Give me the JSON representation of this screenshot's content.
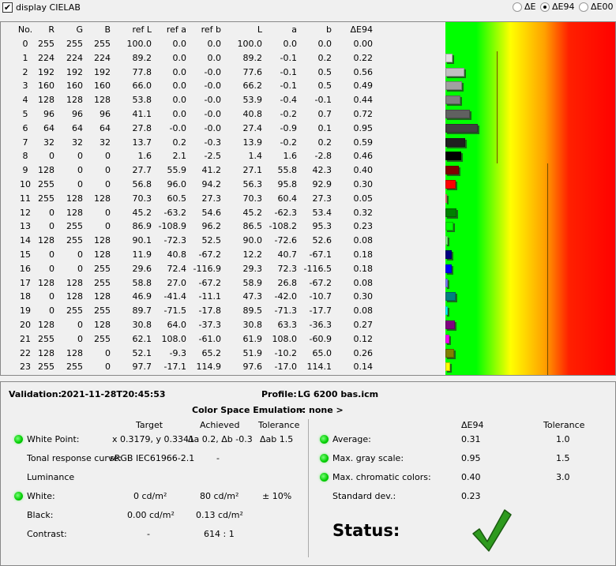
{
  "topbar": {
    "display_cielab_label": "display CIELAB",
    "display_cielab_checked": true,
    "metric_options": [
      "ΔE",
      "ΔE94",
      "ΔE00"
    ],
    "selected_metric": "ΔE94"
  },
  "table": {
    "headers": [
      "No.",
      "R",
      "G",
      "B",
      "ref L",
      "ref a",
      "ref b",
      "L",
      "a",
      "b",
      "ΔE94"
    ],
    "rows": [
      [
        "0",
        "255",
        "255",
        "255",
        "100.0",
        "0.0",
        "0.0",
        "100.0",
        "0.0",
        "0.0",
        "0.00"
      ],
      [
        "1",
        "224",
        "224",
        "224",
        "89.2",
        "0.0",
        "0.0",
        "89.2",
        "-0.1",
        "0.2",
        "0.22"
      ],
      [
        "2",
        "192",
        "192",
        "192",
        "77.8",
        "0.0",
        "-0.0",
        "77.6",
        "-0.1",
        "0.5",
        "0.56"
      ],
      [
        "3",
        "160",
        "160",
        "160",
        "66.0",
        "0.0",
        "-0.0",
        "66.2",
        "-0.1",
        "0.5",
        "0.49"
      ],
      [
        "4",
        "128",
        "128",
        "128",
        "53.8",
        "0.0",
        "-0.0",
        "53.9",
        "-0.4",
        "-0.1",
        "0.44"
      ],
      [
        "5",
        "96",
        "96",
        "96",
        "41.1",
        "0.0",
        "-0.0",
        "40.8",
        "-0.2",
        "0.7",
        "0.72"
      ],
      [
        "6",
        "64",
        "64",
        "64",
        "27.8",
        "-0.0",
        "-0.0",
        "27.4",
        "-0.9",
        "0.1",
        "0.95"
      ],
      [
        "7",
        "32",
        "32",
        "32",
        "13.7",
        "0.2",
        "-0.3",
        "13.9",
        "-0.2",
        "0.2",
        "0.59"
      ],
      [
        "8",
        "0",
        "0",
        "0",
        "1.6",
        "2.1",
        "-2.5",
        "1.4",
        "1.6",
        "-2.8",
        "0.46"
      ],
      [
        "9",
        "128",
        "0",
        "0",
        "27.7",
        "55.9",
        "41.2",
        "27.1",
        "55.8",
        "42.3",
        "0.40"
      ],
      [
        "10",
        "255",
        "0",
        "0",
        "56.8",
        "96.0",
        "94.2",
        "56.3",
        "95.8",
        "92.9",
        "0.30"
      ],
      [
        "11",
        "255",
        "128",
        "128",
        "70.3",
        "60.5",
        "27.3",
        "70.3",
        "60.4",
        "27.3",
        "0.05"
      ],
      [
        "12",
        "0",
        "128",
        "0",
        "45.2",
        "-63.2",
        "54.6",
        "45.2",
        "-62.3",
        "53.4",
        "0.32"
      ],
      [
        "13",
        "0",
        "255",
        "0",
        "86.9",
        "-108.9",
        "96.2",
        "86.5",
        "-108.2",
        "95.3",
        "0.23"
      ],
      [
        "14",
        "128",
        "255",
        "128",
        "90.1",
        "-72.3",
        "52.5",
        "90.0",
        "-72.6",
        "52.6",
        "0.08"
      ],
      [
        "15",
        "0",
        "0",
        "128",
        "11.9",
        "40.8",
        "-67.2",
        "12.2",
        "40.7",
        "-67.1",
        "0.18"
      ],
      [
        "16",
        "0",
        "0",
        "255",
        "29.6",
        "72.4",
        "-116.9",
        "29.3",
        "72.3",
        "-116.5",
        "0.18"
      ],
      [
        "17",
        "128",
        "128",
        "255",
        "58.8",
        "27.0",
        "-67.2",
        "58.9",
        "26.8",
        "-67.2",
        "0.08"
      ],
      [
        "18",
        "0",
        "128",
        "128",
        "46.9",
        "-41.4",
        "-11.1",
        "47.3",
        "-42.0",
        "-10.7",
        "0.30"
      ],
      [
        "19",
        "0",
        "255",
        "255",
        "89.7",
        "-71.5",
        "-17.8",
        "89.5",
        "-71.3",
        "-17.7",
        "0.08"
      ],
      [
        "20",
        "128",
        "0",
        "128",
        "30.8",
        "64.0",
        "-37.3",
        "30.8",
        "63.3",
        "-36.3",
        "0.27"
      ],
      [
        "21",
        "255",
        "0",
        "255",
        "62.1",
        "108.0",
        "-61.0",
        "61.9",
        "108.0",
        "-60.9",
        "0.12"
      ],
      [
        "22",
        "128",
        "128",
        "0",
        "52.1",
        "-9.3",
        "65.2",
        "51.9",
        "-10.2",
        "65.0",
        "0.26"
      ],
      [
        "23",
        "255",
        "255",
        "0",
        "97.7",
        "-17.1",
        "114.9",
        "97.6",
        "-17.0",
        "114.1",
        "0.14"
      ]
    ],
    "gray_tolerance": 1.5,
    "chromatic_tolerance": 3.0
  },
  "summary": {
    "validation_label": "Validation:",
    "validation_value": "2021-11-28T20:45:53",
    "profile_label": "Profile:",
    "profile_value": "LG 6200 bas.icm",
    "emulation_label": "Color Space Emulation:",
    "emulation_value": "< none >",
    "left": {
      "col_target": "Target",
      "col_achieved": "Achieved",
      "col_tolerance": "Tolerance",
      "white_point_label": "White Point:",
      "white_point_target": "x 0.3179, y 0.3341",
      "white_point_achieved": "Δa 0.2, Δb -0.3",
      "white_point_tolerance": "Δab 1.5",
      "trc_label": "Tonal response curve:",
      "trc_target": "sRGB IEC61966-2.1",
      "trc_achieved": "-",
      "luminance_label": "Luminance",
      "white_label": "White:",
      "white_target": "0 cd/m²",
      "white_achieved": "80 cd/m²",
      "white_tolerance": "± 10%",
      "black_label": "Black:",
      "black_target": "0.00 cd/m²",
      "black_achieved": "0.13 cd/m²",
      "contrast_label": "Contrast:",
      "contrast_target": "-",
      "contrast_achieved": "614 : 1"
    },
    "right": {
      "col_de": "ΔE94",
      "col_tolerance": "Tolerance",
      "average_label": "Average:",
      "average_value": "0.31",
      "average_tolerance": "1.0",
      "max_gray_label": "Max. gray scale:",
      "max_gray_value": "0.95",
      "max_gray_tolerance": "1.5",
      "max_chroma_label": "Max. chromatic colors:",
      "max_chroma_value": "0.40",
      "max_chroma_tolerance": "3.0",
      "stddev_label": "Standard dev.:",
      "stddev_value": "0.23",
      "status_label": "Status:",
      "status": "pass"
    }
  },
  "colors": {
    "pass_green": "#2e9a1e",
    "indicator_green": "#00cc00"
  }
}
